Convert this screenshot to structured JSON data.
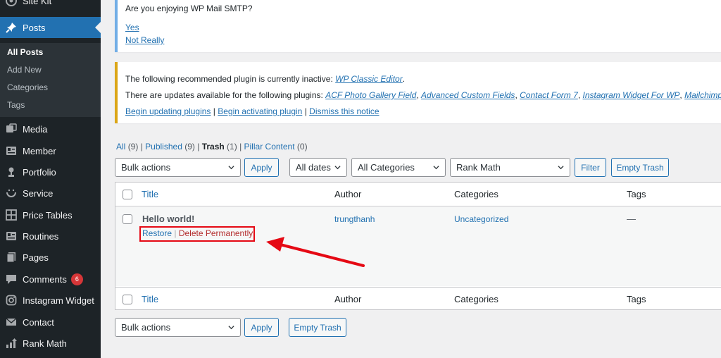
{
  "sidebar": {
    "items": [
      {
        "label": "Site Kit",
        "icon": "site-kit-icon"
      },
      {
        "label": "Posts",
        "icon": "pin-icon",
        "active": true
      },
      {
        "label": "Media",
        "icon": "media-icon"
      },
      {
        "label": "Member",
        "icon": "member-icon"
      },
      {
        "label": "Portfolio",
        "icon": "portfolio-icon"
      },
      {
        "label": "Service",
        "icon": "service-icon"
      },
      {
        "label": "Price Tables",
        "icon": "grid-icon"
      },
      {
        "label": "Routines",
        "icon": "routines-icon"
      },
      {
        "label": "Pages",
        "icon": "pages-icon"
      },
      {
        "label": "Comments",
        "icon": "comment-icon",
        "badge": "6"
      },
      {
        "label": "Instagram Widget",
        "icon": "instagram-icon"
      },
      {
        "label": "Contact",
        "icon": "mail-icon"
      },
      {
        "label": "Rank Math",
        "icon": "chart-icon"
      }
    ],
    "submenu": [
      "All Posts",
      "Add New",
      "Categories",
      "Tags"
    ],
    "colors": {
      "background": "#1d2327",
      "active": "#2271b1",
      "submenu": "#2c3338"
    }
  },
  "notices": {
    "smtp": {
      "question": "Are you enjoying WP Mail SMTP?",
      "yes": "Yes",
      "no": "Not Really"
    },
    "plugins": {
      "line1_prefix": "The following recommended plugin is currently inactive: ",
      "line1_link": "WP Classic Editor",
      "line1_suffix": ".",
      "line2_prefix": "There are updates available for the following plugins: ",
      "line2_links": [
        "ACF Photo Gallery Field",
        "Advanced Custom Fields",
        "Contact Form 7",
        "Instagram Widget For WP",
        "Mailchimp For"
      ],
      "actions": [
        "Begin updating plugins",
        "Begin activating plugin",
        "Dismiss this notice"
      ]
    }
  },
  "filters": {
    "views": [
      {
        "label": "All",
        "count": "(9)"
      },
      {
        "label": "Published",
        "count": "(9)"
      },
      {
        "label": "Trash",
        "count": "(1)",
        "current": true
      },
      {
        "label": "Pillar Content",
        "count": "(0)"
      }
    ],
    "bulk_actions": "Bulk actions",
    "apply": "Apply",
    "dates": "All dates",
    "categories": "All Categories",
    "seo": "Rank Math",
    "filter": "Filter",
    "empty_trash": "Empty Trash"
  },
  "table": {
    "columns": [
      "Title",
      "Author",
      "Categories",
      "Tags"
    ],
    "rows": [
      {
        "title": "Hello world!",
        "author": "trungthanh",
        "category": "Uncategorized",
        "tags": "—",
        "actions": {
          "restore": "Restore",
          "separator": "|",
          "delete": "Delete Permanently"
        }
      }
    ]
  },
  "annotation": {
    "color": "#e50914"
  }
}
